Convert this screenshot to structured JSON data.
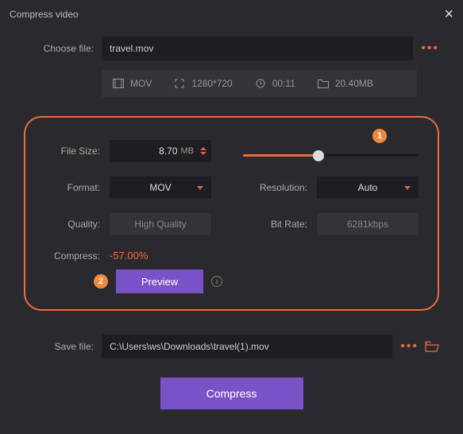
{
  "window": {
    "title": "Compress video"
  },
  "chooseFile": {
    "label": "Choose file:",
    "value": "travel.mov"
  },
  "meta": {
    "format": "MOV",
    "resolution": "1280*720",
    "duration": "00:11",
    "size": "20.40MB"
  },
  "panel": {
    "fileSizeLabel": "File Size:",
    "fileSizeValue": "8.70",
    "fileSizeUnit": "MB",
    "sliderPercent": 43,
    "callout1": "1",
    "formatLabel": "Format:",
    "formatValue": "MOV",
    "resolutionLabel": "Resolution:",
    "resolutionValue": "Auto",
    "qualityLabel": "Quality:",
    "qualityValue": "High Quality",
    "bitRateLabel": "Bit Rate:",
    "bitRateValue": "6281kbps",
    "compressLabel": "Compress:",
    "compressValue": "-57.00%",
    "callout2": "2",
    "previewLabel": "Preview"
  },
  "saveFile": {
    "label": "Save file:",
    "value": "C:\\Users\\ws\\Downloads\\travel(1).mov"
  },
  "footer": {
    "compressLabel": "Compress"
  }
}
